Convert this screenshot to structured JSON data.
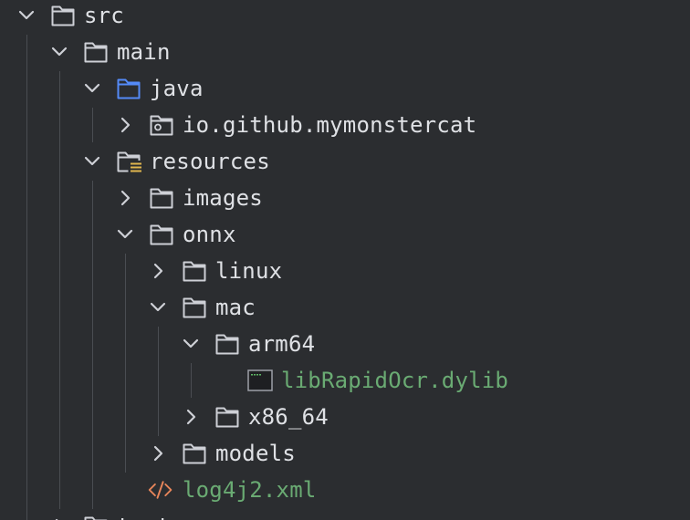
{
  "project_tree": {
    "items": [
      {
        "label": "src",
        "expanded": true,
        "icon": "folder-icon"
      },
      {
        "label": "main",
        "expanded": true,
        "icon": "folder-icon"
      },
      {
        "label": "java",
        "expanded": true,
        "icon": "source-root-folder-icon"
      },
      {
        "label": "io.github.mymonstercat",
        "expanded": false,
        "icon": "package-icon"
      },
      {
        "label": "resources",
        "expanded": true,
        "icon": "resources-folder-icon"
      },
      {
        "label": "images",
        "expanded": false,
        "icon": "folder-icon"
      },
      {
        "label": "onnx",
        "expanded": true,
        "icon": "folder-icon"
      },
      {
        "label": "linux",
        "expanded": false,
        "icon": "folder-icon"
      },
      {
        "label": "mac",
        "expanded": true,
        "icon": "folder-icon"
      },
      {
        "label": "arm64",
        "expanded": true,
        "icon": "folder-icon"
      },
      {
        "label": "libRapidOcr.dylib",
        "icon": "binary-file-icon",
        "color": "#6aab73"
      },
      {
        "label": "x86_64",
        "expanded": false,
        "icon": "folder-icon"
      },
      {
        "label": "models",
        "expanded": false,
        "icon": "folder-icon"
      },
      {
        "label": "log4j2.xml",
        "icon": "xml-file-icon",
        "color": "#6aab73"
      },
      {
        "label": "test",
        "expanded": false,
        "icon": "folder-icon"
      }
    ]
  },
  "colors": {
    "background": "#2b2d30",
    "text": "#dfe1e5",
    "green_text": "#6aab73",
    "source_root_blue": "#548af7",
    "xml_orange": "#e8855a",
    "resources_yellow": "#e0b64e"
  }
}
